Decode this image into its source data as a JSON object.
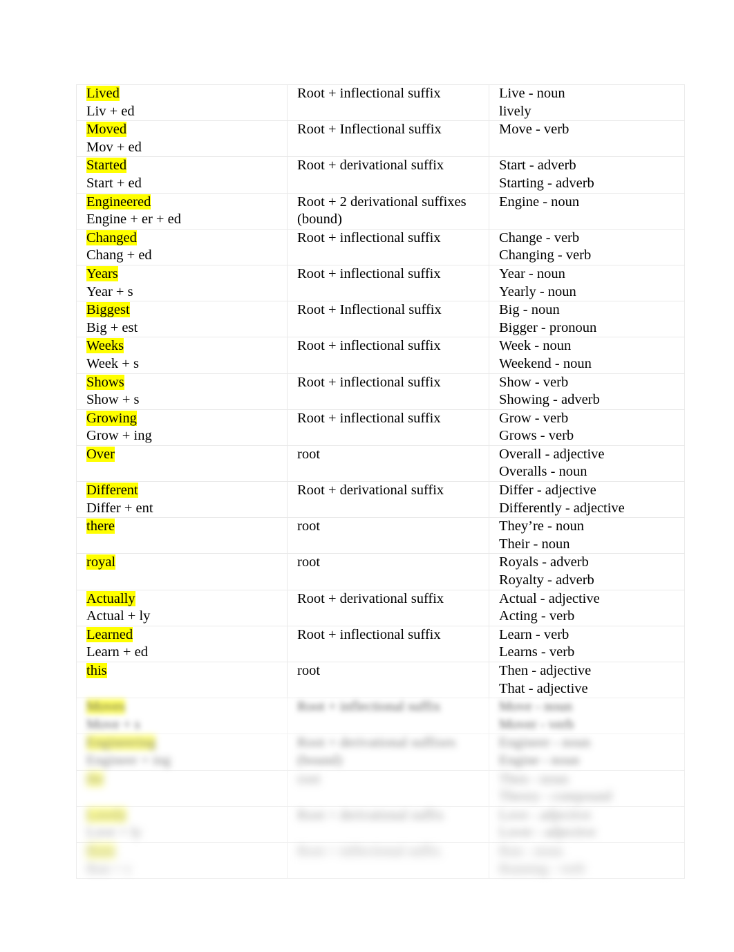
{
  "document": {
    "type": "morphology-analysis-table",
    "columns": [
      "word-and-decomposition",
      "morphological-structure",
      "related-forms"
    ],
    "highlight_color": "#ffff00",
    "page_background": "#ffffff"
  },
  "rows": [
    {
      "word": "Lived",
      "decomposition": "Liv + ed",
      "structure": "Root + inflectional suffix",
      "structure_line2": "",
      "related_1": "Live - noun",
      "related_2": "lively",
      "blurred": false
    },
    {
      "word": "Moved",
      "decomposition": "Mov + ed",
      "structure": "Root + Inflectional suffix",
      "structure_line2": "",
      "related_1": "Move - verb",
      "related_2": "",
      "blurred": false
    },
    {
      "word": "Started",
      "decomposition": "Start + ed",
      "structure": "Root + derivational suffix",
      "structure_line2": "",
      "related_1": "Start - adverb",
      "related_2": "Starting - adverb",
      "blurred": false
    },
    {
      "word": "Engineered",
      "decomposition": "Engine + er + ed",
      "structure": "Root + 2 derivational suffixes",
      "structure_line2": "(bound)",
      "related_1": "Engine - noun",
      "related_2": "",
      "blurred": false
    },
    {
      "word": "Changed",
      "decomposition": "Chang + ed",
      "structure": "Root + inflectional suffix",
      "structure_line2": "",
      "related_1": "Change - verb",
      "related_2": "Changing - verb",
      "blurred": false
    },
    {
      "word": "Years",
      "decomposition": "Year + s",
      "structure": "Root + inflectional suffix",
      "structure_line2": "",
      "related_1": "Year - noun",
      "related_2": "Yearly - noun",
      "blurred": false
    },
    {
      "word": "Biggest",
      "decomposition": "Big + est",
      "structure": "Root + Inflectional suffix",
      "structure_line2": "",
      "related_1": "Big - noun",
      "related_2": "Bigger - pronoun",
      "blurred": false
    },
    {
      "word": "Weeks",
      "decomposition": "Week + s",
      "structure": "Root + inflectional suffix",
      "structure_line2": "",
      "related_1": "Week - noun",
      "related_2": "Weekend - noun",
      "blurred": false
    },
    {
      "word": "Shows",
      "decomposition": "Show + s",
      "structure": "Root + inflectional suffix",
      "structure_line2": "",
      "related_1": "Show - verb",
      "related_2": "Showing - adverb",
      "blurred": false
    },
    {
      "word": "Growing",
      "decomposition": "Grow + ing",
      "structure": "Root + inflectional suffix",
      "structure_line2": "",
      "related_1": "Grow - verb",
      "related_2": "Grows - verb",
      "blurred": false
    },
    {
      "word": "Over",
      "decomposition": "",
      "structure": "root",
      "structure_line2": "",
      "related_1": "Overall - adjective",
      "related_2": "Overalls - noun",
      "blurred": false
    },
    {
      "word": "Different",
      "decomposition": "Differ + ent",
      "structure": "Root + derivational suffix",
      "structure_line2": "",
      "related_1": "Differ - adjective",
      "related_2": "Differently - adjective",
      "blurred": false
    },
    {
      "word": "there",
      "decomposition": "",
      "structure": "root",
      "structure_line2": "",
      "related_1": "They’re - noun",
      "related_2": "Their - noun",
      "blurred": false
    },
    {
      "word": "royal",
      "decomposition": "",
      "structure": "root",
      "structure_line2": "",
      "related_1": "Royals - adverb",
      "related_2": "Royalty - adverb",
      "blurred": false
    },
    {
      "word": "Actually",
      "decomposition": "Actual + ly",
      "structure": "Root + derivational suffix",
      "structure_line2": "",
      "related_1": "Actual - adjective",
      "related_2": "Acting - verb",
      "blurred": false
    },
    {
      "word": "Learned",
      "decomposition": "Learn + ed",
      "structure": "Root + inflectional suffix",
      "structure_line2": "",
      "related_1": "Learn - verb",
      "related_2": "Learns - verb",
      "blurred": false
    },
    {
      "word": "this",
      "decomposition": "",
      "structure": "root",
      "structure_line2": "",
      "related_1": "Then - adjective",
      "related_2": "That - adjective",
      "blurred": false
    },
    {
      "word": "Moves",
      "decomposition": "Move + s",
      "structure": "Root + inflectional suffix",
      "structure_line2": "",
      "related_1": "Move - noun",
      "related_2": "Mover - verb",
      "blurred": true,
      "blur_level": 1
    },
    {
      "word": "Engineering",
      "decomposition": "Engineer + ing",
      "structure": "Root + derivational suffixes",
      "structure_line2": "(bound)",
      "related_1": "Engineer - noun",
      "related_2": "Engine - noun",
      "blurred": true,
      "blur_level": 2
    },
    {
      "word": "the",
      "decomposition": "",
      "structure": "root",
      "structure_line2": "",
      "related_1": "Then - noun",
      "related_2": "Theory - compound",
      "blurred": true,
      "blur_level": 3
    },
    {
      "word": "Lovely",
      "decomposition": "Love + ly",
      "structure": "Root + derivational suffix",
      "structure_line2": "",
      "related_1": "Love - adjective",
      "related_2": "Lover - adjective",
      "blurred": true,
      "blur_level": 3
    },
    {
      "word": "Runs",
      "decomposition": "Run + s",
      "structure": "Root + inflectional suffix",
      "structure_line2": "",
      "related_1": "Run - noun",
      "related_2": "Running - verb",
      "blurred": true,
      "blur_level": 4
    }
  ]
}
